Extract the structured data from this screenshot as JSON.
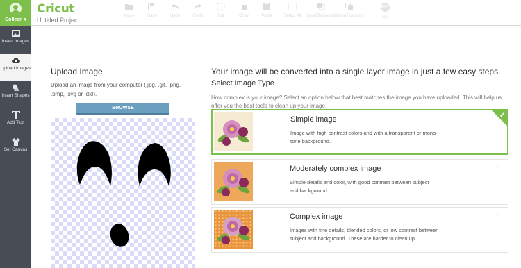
{
  "user": {
    "name": "Colleen"
  },
  "app": {
    "logo": "Cricut",
    "project_name": "Untitled Project"
  },
  "toolbar": {
    "items": [
      {
        "label": "File",
        "icon": "folder-icon"
      },
      {
        "label": "Save",
        "icon": "save-icon"
      },
      {
        "label": "Undo",
        "icon": "undo-icon"
      },
      {
        "label": "Redo",
        "icon": "redo-icon"
      },
      {
        "label": "Cut",
        "icon": "cut-icon"
      },
      {
        "label": "Copy",
        "icon": "copy-icon"
      },
      {
        "label": "Paste",
        "icon": "paste-icon"
      },
      {
        "label": "Select All",
        "icon": "select-all-icon"
      },
      {
        "label": "Send Backward",
        "icon": "send-backward-icon"
      },
      {
        "label": "Bring Forward",
        "icon": "bring-forward-icon"
      }
    ],
    "go": {
      "label": "Go",
      "badge": "GO"
    }
  },
  "sidebar": {
    "items": [
      {
        "label": "Insert Images",
        "icon": "image-icon"
      },
      {
        "label": "Upload Images",
        "icon": "cloud-upload-icon"
      },
      {
        "label": "Insert Shapes",
        "icon": "shapes-icon"
      },
      {
        "label": "Add Text",
        "icon": "text-icon"
      },
      {
        "label": "Set Canvas",
        "icon": "shirt-icon"
      }
    ]
  },
  "upload": {
    "title": "Upload Image",
    "description": "Upload an image from your computer (.jpg, .gif, .png, .bmp, .svg or .dxf).",
    "browse_label": "BROWSE"
  },
  "convert": {
    "headline": "Your image will be converted into a single layer image in just a few easy steps.",
    "subhead": "Select Image Type",
    "question": "How complex is your image? Select an option below that best matches the image you have uploaded. This will help us offer you the best tools to clean up your image.",
    "options": [
      {
        "title": "Simple image",
        "description": "Image with high contrast colors and with a transparent or mono-tone background.",
        "selected": true
      },
      {
        "title": "Moderately complex image",
        "description": "Simple details and color, with good contrast between subject and background.",
        "selected": false
      },
      {
        "title": "Complex image",
        "description": "Images with fine details, blended colors, or low contrast between subject and background. These are harder to clean up.",
        "selected": false
      }
    ]
  },
  "colors": {
    "accent_green": "#7cc04b",
    "sidebar_bg": "#484d55",
    "browse_blue": "#6a9fc0",
    "checker": "#d8dcf6"
  }
}
